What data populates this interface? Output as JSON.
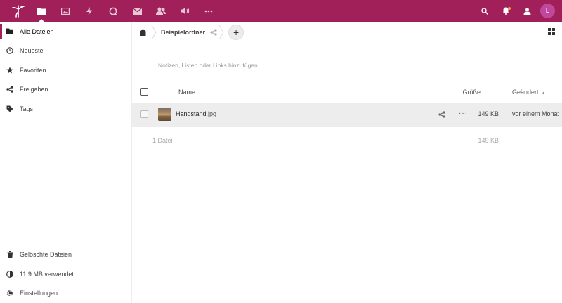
{
  "header": {
    "apps": [
      "files-icon",
      "photos-icon",
      "activity-icon",
      "talk-icon",
      "mail-icon",
      "contacts-icon",
      "announcements-icon",
      "more-apps-icon"
    ],
    "avatar_initial": "L",
    "brand_color": "#a1205a"
  },
  "sidebar": {
    "items": [
      {
        "label": "Alle Dateien",
        "icon": "folder-icon"
      },
      {
        "label": "Neueste",
        "icon": "clock-icon"
      },
      {
        "label": "Favoriten",
        "icon": "star-icon"
      },
      {
        "label": "Freigaben",
        "icon": "share-icon"
      },
      {
        "label": "Tags",
        "icon": "tag-icon"
      }
    ],
    "bottom": [
      {
        "label": "Gelöschte Dateien",
        "icon": "trash-icon"
      },
      {
        "label": "11.9 MB verwendet",
        "icon": "quota-icon"
      },
      {
        "label": "Einstellungen",
        "icon": "gear-icon"
      }
    ]
  },
  "breadcrumb": {
    "folder": "Beispielordner",
    "add_label": "+"
  },
  "notes_placeholder": "Notizen, Listen oder Links hinzufügen…",
  "table": {
    "col_name": "Name",
    "col_size": "Größe",
    "col_modified": "Geändert",
    "rows": [
      {
        "name": "Handstand",
        "ext": ".jpg",
        "size": "149 KB",
        "modified": "vor einem Monat"
      }
    ],
    "summary_count": "1 Datei",
    "summary_size": "149 KB"
  }
}
